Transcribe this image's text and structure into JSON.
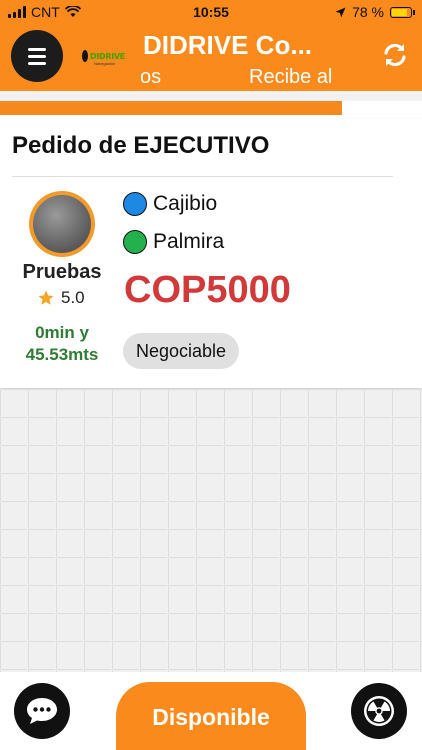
{
  "status_bar": {
    "carrier": "CNT",
    "time": "10:55",
    "battery": "78 %",
    "battery_level": 0.78
  },
  "header": {
    "title": "DIDRIVE Co...",
    "marquee_part1": "os",
    "marquee_part2": "Recibe al",
    "logo_text": "DIDRIVE",
    "logo_subtext": "Navegación",
    "icons": [
      "menu-icon",
      "refresh-icon"
    ]
  },
  "progress": {
    "value": 0.81,
    "color": "#f5891e"
  },
  "order": {
    "title": "Pedido de EJECUTIVO",
    "driver_name": "Pruebas",
    "rating": "5.0",
    "eta_line1": "0min y",
    "eta_line2": "45.53mts",
    "origin": "Cajibio",
    "destination": "Palmira",
    "origin_color": "#1e88e5",
    "destination_color": "#22b14c",
    "price": "COP5000",
    "price_color": "#d23a3a",
    "badge": "Negociable"
  },
  "footer": {
    "available_label": "Disponible",
    "icons": [
      "chat-icon",
      "radiation-icon"
    ]
  },
  "colors": {
    "accent": "#fb8a1c"
  }
}
